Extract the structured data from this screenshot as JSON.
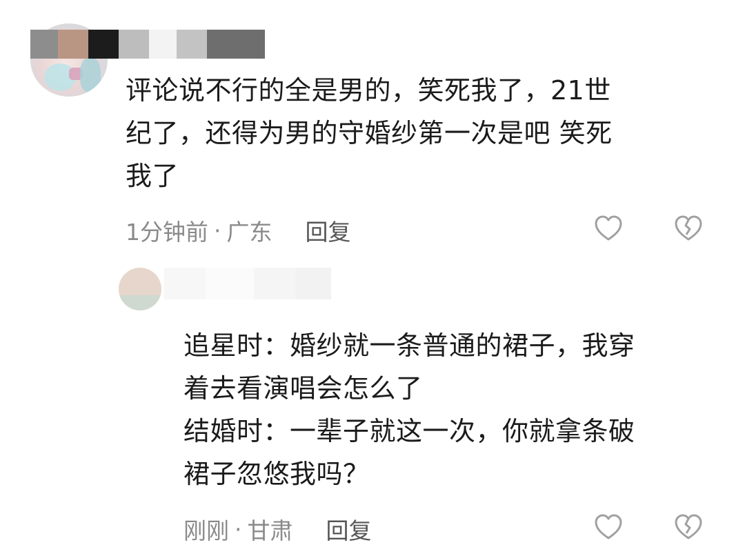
{
  "comment_1": {
    "text": "评论说不行的全是男的，笑死我了，21世\n纪了，还得为男的守婚纱第一次是吧 笑死\n我了",
    "time": "1分钟前",
    "separator": "·",
    "location": "广东",
    "reply_label": "回复",
    "like_icon": "heart-outline",
    "dislike_icon": "broken-heart-outline"
  },
  "comment_2": {
    "text": "追星时：婚纱就一条普通的裙子，我穿\n着去看演唱会怎么了\n结婚时：一辈子就这一次，你就拿条破\n裙子忽悠我吗？",
    "time": "刚刚",
    "separator": "·",
    "location": "甘肃",
    "reply_label": "回复",
    "like_icon": "heart-outline",
    "dislike_icon": "broken-heart-outline"
  },
  "colors": {
    "meta_gray": "#8a8a8a",
    "icon_gray": "#a0a0a0",
    "text": "#1b1b1b"
  }
}
